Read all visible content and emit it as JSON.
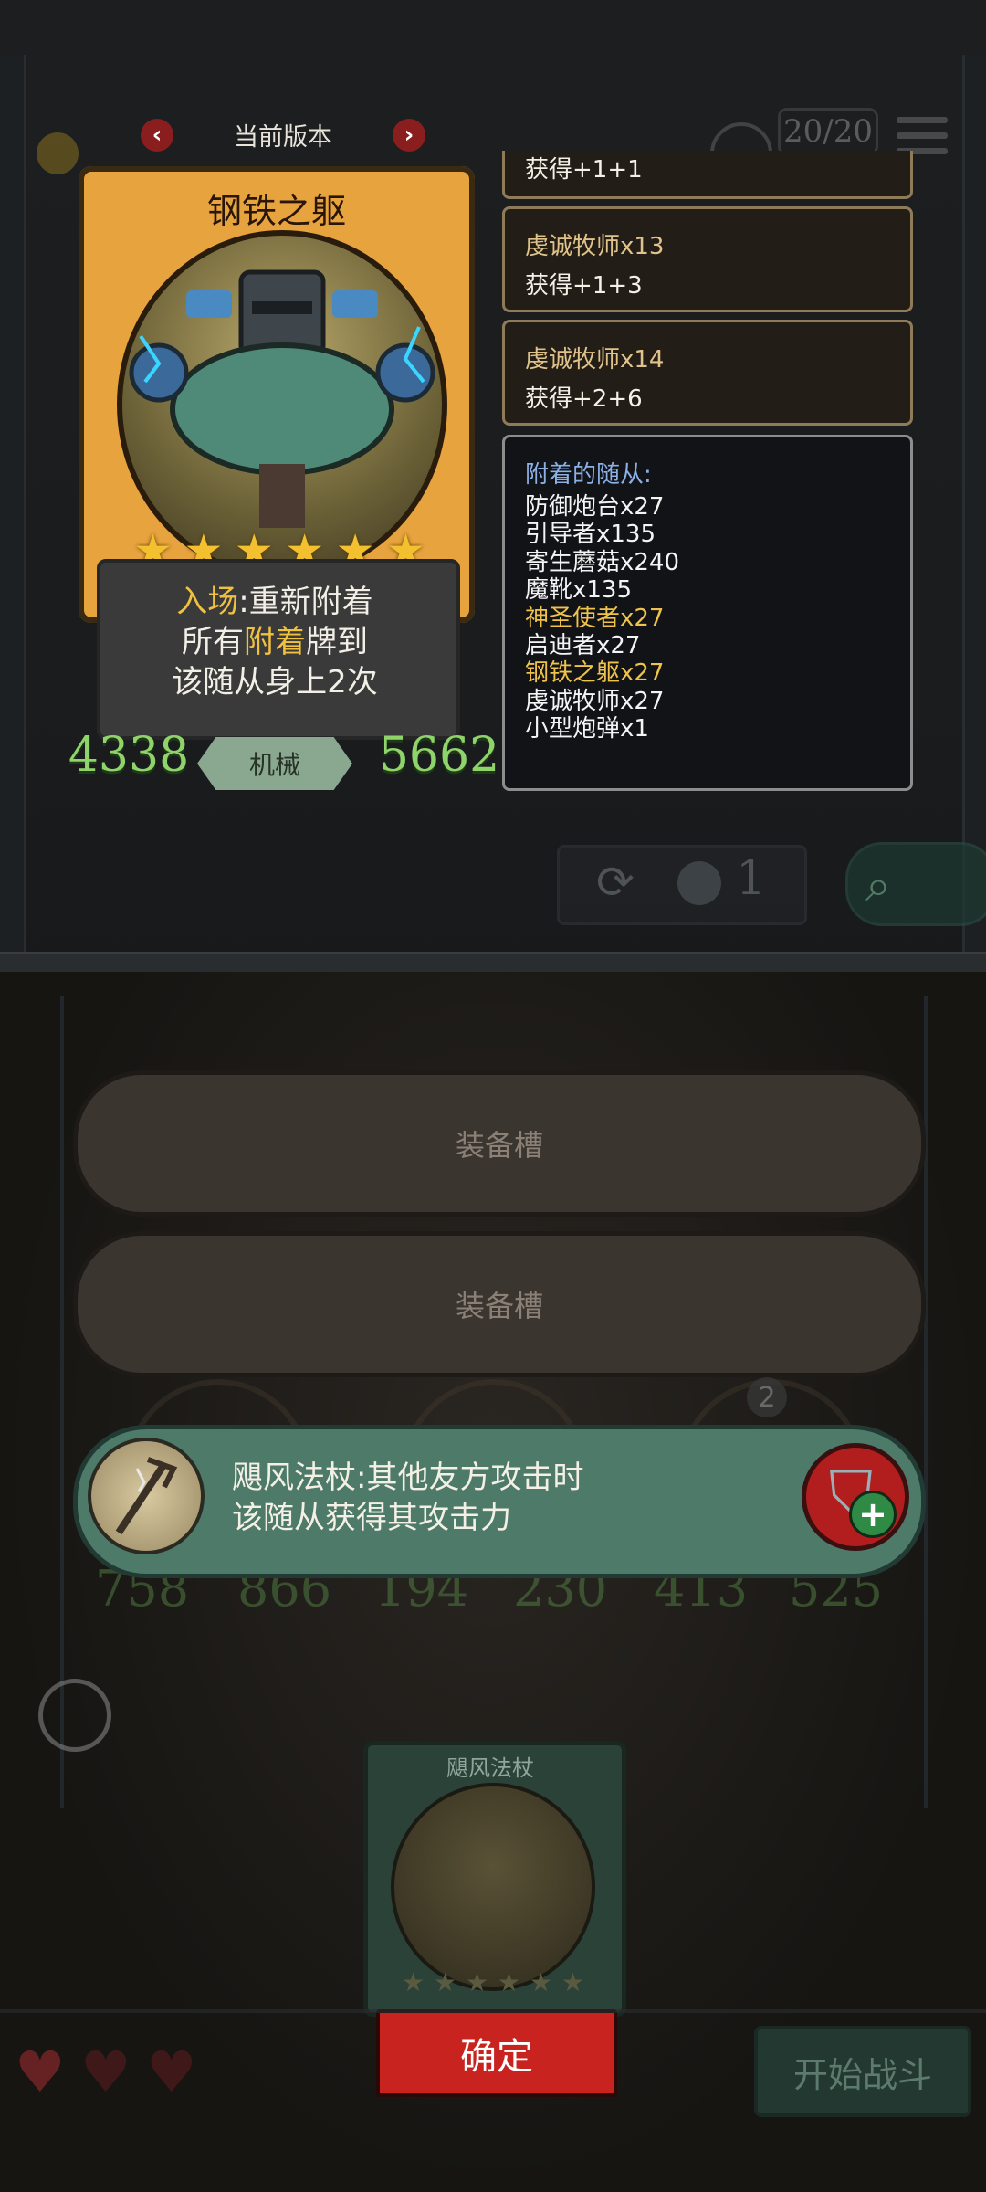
{
  "hud": {
    "counter": "20/20"
  },
  "version_switch": {
    "label": "当前版本",
    "prev": "‹",
    "next": "›"
  },
  "card": {
    "name": "钢铁之躯",
    "stars": 6,
    "description": {
      "line1_prefix": "入场",
      "line1_rest": ":重新附着",
      "line2_a": "所有",
      "line2_hl": "附着",
      "line2_b": "牌到",
      "line3": "该随从身上2次"
    },
    "attack": "4338",
    "tribe": "机械",
    "health": "5662"
  },
  "info_boxes": [
    {
      "title": "",
      "text": "获得+1+1"
    },
    {
      "title": "虔诚牧师x13",
      "text": "获得+1+3"
    },
    {
      "title": "虔诚牧师x14",
      "text": "获得+2+6"
    }
  ],
  "attached": {
    "title": "附着的随从:",
    "items": [
      {
        "text": "防御炮台x27",
        "highlight": false
      },
      {
        "text": "引导者x135",
        "highlight": false
      },
      {
        "text": "寄生蘑菇x240",
        "highlight": false
      },
      {
        "text": "魔靴x135",
        "highlight": false
      },
      {
        "text": "神圣使者x27",
        "highlight": true
      },
      {
        "text": "启迪者x27",
        "highlight": false
      },
      {
        "text": "钢铁之躯x27",
        "highlight": true
      },
      {
        "text": "虔诚牧师x27",
        "highlight": false
      },
      {
        "text": "小型炮弹x1",
        "highlight": false
      }
    ]
  },
  "refresh": {
    "cost": "1"
  },
  "equip_slots": [
    "装备槽",
    "装备槽"
  ],
  "minions_row": {
    "badge": "2",
    "stats": [
      "758",
      "866",
      "194",
      "230",
      "413",
      "525"
    ]
  },
  "equip_tooltip": {
    "line1": "飓风法杖:其他友方攻击时",
    "line2": "该随从获得其攻击力"
  },
  "hand_card": {
    "name": "飓风法杖",
    "stars": 6,
    "confirm_label": "确定"
  },
  "start_battle_label": "开始战斗",
  "colors": {
    "accent_gold": "#f0c040",
    "stat_green": "#8fd46a",
    "confirm_red": "#c8231f",
    "tooltip_green": "#4e7a69"
  }
}
